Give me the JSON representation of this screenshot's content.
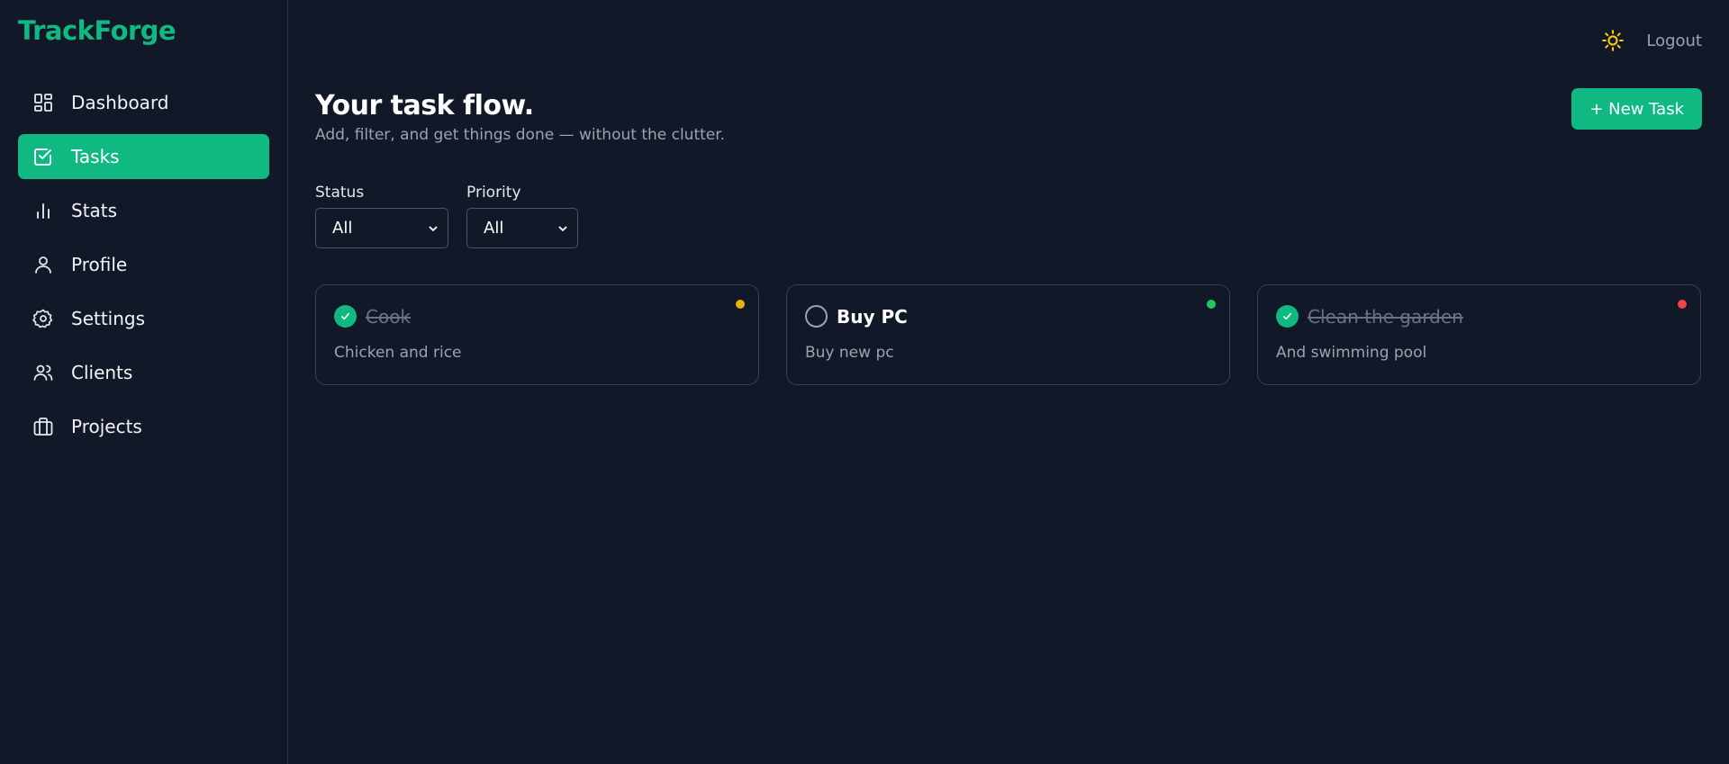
{
  "app": {
    "brand": "TrackForge"
  },
  "colors": {
    "accent": "#10b981",
    "background": "#111827",
    "priority_medium": "#eab308",
    "priority_low": "#22c55e",
    "priority_high": "#ef4444",
    "sun": "#facc15"
  },
  "sidebar": {
    "items": [
      {
        "label": "Dashboard",
        "icon": "dashboard-icon",
        "active": false
      },
      {
        "label": "Tasks",
        "icon": "tasks-check-icon",
        "active": true
      },
      {
        "label": "Stats",
        "icon": "bar-chart-icon",
        "active": false
      },
      {
        "label": "Profile",
        "icon": "user-icon",
        "active": false
      },
      {
        "label": "Settings",
        "icon": "gear-icon",
        "active": false
      },
      {
        "label": "Clients",
        "icon": "users-icon",
        "active": false
      },
      {
        "label": "Projects",
        "icon": "briefcase-icon",
        "active": false
      }
    ]
  },
  "topbar": {
    "theme_icon": "sun-icon",
    "logout_label": "Logout"
  },
  "header": {
    "title": "Your task flow.",
    "subtitle": "Add, filter, and get things done — without the clutter.",
    "new_task_label": "+ New Task"
  },
  "filters": {
    "status": {
      "label": "Status",
      "value": "All"
    },
    "priority": {
      "label": "Priority",
      "value": "All"
    }
  },
  "tasks": [
    {
      "title": "Cook",
      "description": "Chicken and rice",
      "done": true,
      "priority_color": "#eab308"
    },
    {
      "title": "Buy PC",
      "description": "Buy new pc",
      "done": false,
      "priority_color": "#22c55e"
    },
    {
      "title": "Clean the garden",
      "description": "And swimming pool",
      "done": true,
      "priority_color": "#ef4444"
    }
  ]
}
